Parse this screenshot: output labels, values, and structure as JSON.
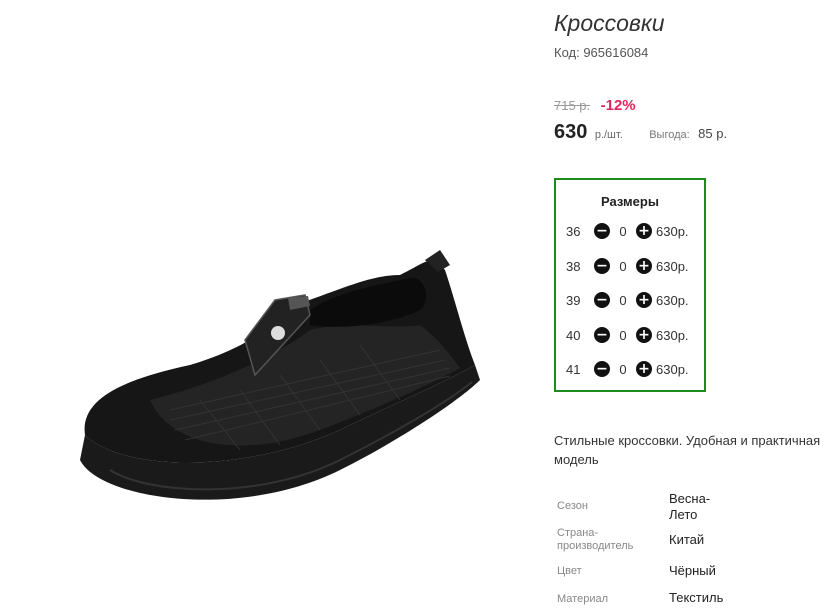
{
  "product": {
    "title": "Кроссовки",
    "code": "Код: 965616084",
    "old_price": "715 р.",
    "discount": "-12%",
    "price": "630",
    "price_unit": "р./шт.",
    "savings_label": "Выгода:",
    "savings_value": "85 р.",
    "description": "Стильные кроссовки. Удобная и практичная модель",
    "image_icon": "sneaker-product-photo"
  },
  "sizes": {
    "title": "Размеры",
    "rows": [
      {
        "size": "36",
        "qty": "0",
        "price": "630р."
      },
      {
        "size": "38",
        "qty": "0",
        "price": "630р."
      },
      {
        "size": "39",
        "qty": "0",
        "price": "630р."
      },
      {
        "size": "40",
        "qty": "0",
        "price": "630р."
      },
      {
        "size": "41",
        "qty": "0",
        "price": "630р."
      }
    ],
    "minus_icon": "−",
    "plus_icon": "+"
  },
  "specs": [
    {
      "label": "Сезон",
      "value": "Весна-Лето"
    },
    {
      "label": "Страна-производитель",
      "value": "Китай"
    },
    {
      "label": "Цвет",
      "value": "Чёрный"
    },
    {
      "label": "Материал",
      "value": "Текстиль"
    }
  ],
  "colors": {
    "accent_border": "#1c8a1c",
    "discount": "#e0245e"
  }
}
